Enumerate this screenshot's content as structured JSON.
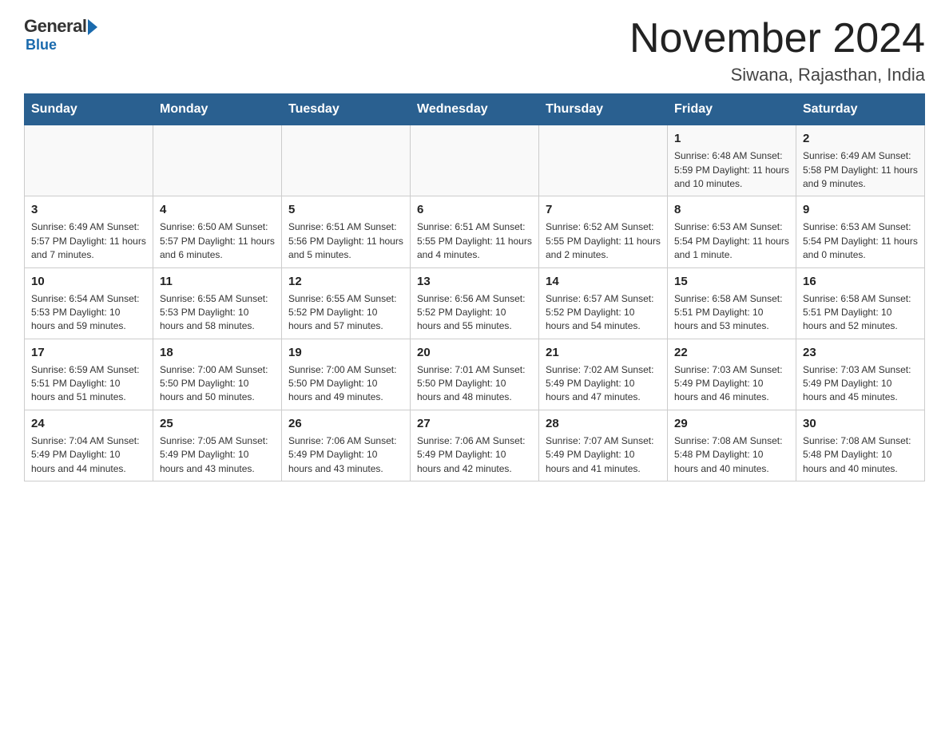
{
  "logo": {
    "general": "General",
    "blue": "Blue"
  },
  "title": "November 2024",
  "location": "Siwana, Rajasthan, India",
  "days_of_week": [
    "Sunday",
    "Monday",
    "Tuesday",
    "Wednesday",
    "Thursday",
    "Friday",
    "Saturday"
  ],
  "weeks": [
    [
      {
        "day": "",
        "info": ""
      },
      {
        "day": "",
        "info": ""
      },
      {
        "day": "",
        "info": ""
      },
      {
        "day": "",
        "info": ""
      },
      {
        "day": "",
        "info": ""
      },
      {
        "day": "1",
        "info": "Sunrise: 6:48 AM\nSunset: 5:59 PM\nDaylight: 11 hours and 10 minutes."
      },
      {
        "day": "2",
        "info": "Sunrise: 6:49 AM\nSunset: 5:58 PM\nDaylight: 11 hours and 9 minutes."
      }
    ],
    [
      {
        "day": "3",
        "info": "Sunrise: 6:49 AM\nSunset: 5:57 PM\nDaylight: 11 hours and 7 minutes."
      },
      {
        "day": "4",
        "info": "Sunrise: 6:50 AM\nSunset: 5:57 PM\nDaylight: 11 hours and 6 minutes."
      },
      {
        "day": "5",
        "info": "Sunrise: 6:51 AM\nSunset: 5:56 PM\nDaylight: 11 hours and 5 minutes."
      },
      {
        "day": "6",
        "info": "Sunrise: 6:51 AM\nSunset: 5:55 PM\nDaylight: 11 hours and 4 minutes."
      },
      {
        "day": "7",
        "info": "Sunrise: 6:52 AM\nSunset: 5:55 PM\nDaylight: 11 hours and 2 minutes."
      },
      {
        "day": "8",
        "info": "Sunrise: 6:53 AM\nSunset: 5:54 PM\nDaylight: 11 hours and 1 minute."
      },
      {
        "day": "9",
        "info": "Sunrise: 6:53 AM\nSunset: 5:54 PM\nDaylight: 11 hours and 0 minutes."
      }
    ],
    [
      {
        "day": "10",
        "info": "Sunrise: 6:54 AM\nSunset: 5:53 PM\nDaylight: 10 hours and 59 minutes."
      },
      {
        "day": "11",
        "info": "Sunrise: 6:55 AM\nSunset: 5:53 PM\nDaylight: 10 hours and 58 minutes."
      },
      {
        "day": "12",
        "info": "Sunrise: 6:55 AM\nSunset: 5:52 PM\nDaylight: 10 hours and 57 minutes."
      },
      {
        "day": "13",
        "info": "Sunrise: 6:56 AM\nSunset: 5:52 PM\nDaylight: 10 hours and 55 minutes."
      },
      {
        "day": "14",
        "info": "Sunrise: 6:57 AM\nSunset: 5:52 PM\nDaylight: 10 hours and 54 minutes."
      },
      {
        "day": "15",
        "info": "Sunrise: 6:58 AM\nSunset: 5:51 PM\nDaylight: 10 hours and 53 minutes."
      },
      {
        "day": "16",
        "info": "Sunrise: 6:58 AM\nSunset: 5:51 PM\nDaylight: 10 hours and 52 minutes."
      }
    ],
    [
      {
        "day": "17",
        "info": "Sunrise: 6:59 AM\nSunset: 5:51 PM\nDaylight: 10 hours and 51 minutes."
      },
      {
        "day": "18",
        "info": "Sunrise: 7:00 AM\nSunset: 5:50 PM\nDaylight: 10 hours and 50 minutes."
      },
      {
        "day": "19",
        "info": "Sunrise: 7:00 AM\nSunset: 5:50 PM\nDaylight: 10 hours and 49 minutes."
      },
      {
        "day": "20",
        "info": "Sunrise: 7:01 AM\nSunset: 5:50 PM\nDaylight: 10 hours and 48 minutes."
      },
      {
        "day": "21",
        "info": "Sunrise: 7:02 AM\nSunset: 5:49 PM\nDaylight: 10 hours and 47 minutes."
      },
      {
        "day": "22",
        "info": "Sunrise: 7:03 AM\nSunset: 5:49 PM\nDaylight: 10 hours and 46 minutes."
      },
      {
        "day": "23",
        "info": "Sunrise: 7:03 AM\nSunset: 5:49 PM\nDaylight: 10 hours and 45 minutes."
      }
    ],
    [
      {
        "day": "24",
        "info": "Sunrise: 7:04 AM\nSunset: 5:49 PM\nDaylight: 10 hours and 44 minutes."
      },
      {
        "day": "25",
        "info": "Sunrise: 7:05 AM\nSunset: 5:49 PM\nDaylight: 10 hours and 43 minutes."
      },
      {
        "day": "26",
        "info": "Sunrise: 7:06 AM\nSunset: 5:49 PM\nDaylight: 10 hours and 43 minutes."
      },
      {
        "day": "27",
        "info": "Sunrise: 7:06 AM\nSunset: 5:49 PM\nDaylight: 10 hours and 42 minutes."
      },
      {
        "day": "28",
        "info": "Sunrise: 7:07 AM\nSunset: 5:49 PM\nDaylight: 10 hours and 41 minutes."
      },
      {
        "day": "29",
        "info": "Sunrise: 7:08 AM\nSunset: 5:48 PM\nDaylight: 10 hours and 40 minutes."
      },
      {
        "day": "30",
        "info": "Sunrise: 7:08 AM\nSunset: 5:48 PM\nDaylight: 10 hours and 40 minutes."
      }
    ]
  ]
}
